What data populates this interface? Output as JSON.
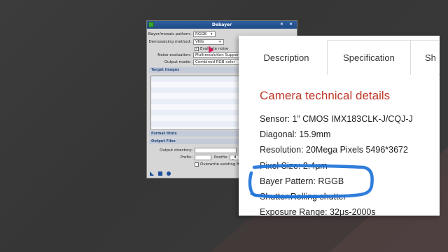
{
  "dialog": {
    "title": "Debayer",
    "controls": "⨯ ⨯",
    "bayer_label": "Bayer/mosaic pattern:",
    "bayer_value": "RGGB",
    "demosaic_label": "Demosaicing method:",
    "demosaic_value": "VNG",
    "evaluate_noise_label": "Evaluate noise",
    "noise_eval_label": "Noise evaluation:",
    "noise_eval_value": "Multiresolution Support",
    "output_mode_label": "Output mode:",
    "output_mode_value": "Combined RGB color",
    "target_images": "Target Images",
    "format_hints": "Format Hints",
    "output_files": "Output Files",
    "output_dir_label": "Output directory:",
    "prefix_label": "Prefix:",
    "postfix_label": "Postfix:",
    "postfix_value": "_d",
    "overwrite_label": "Overwrite existing file"
  },
  "panel": {
    "tabs": [
      "Description",
      "Specification",
      "Sh"
    ],
    "heading": "Camera technical details",
    "specs": [
      "Sensor: 1” CMOS IMX183CLK-J/CQJ-J",
      "Diagonal: 15.9mm",
      "Resolution: 20Mega Pixels 5496*3672",
      "Pixel Size: 2.4μm",
      "Bayer Pattern: RGGB",
      "Shutter:Rolling shutter",
      "Exposure Range: 32μs-2000s"
    ]
  },
  "colors": {
    "heading": "#c0392b",
    "highlight_stroke": "#1e73d8",
    "cursor": "#d81b60"
  }
}
